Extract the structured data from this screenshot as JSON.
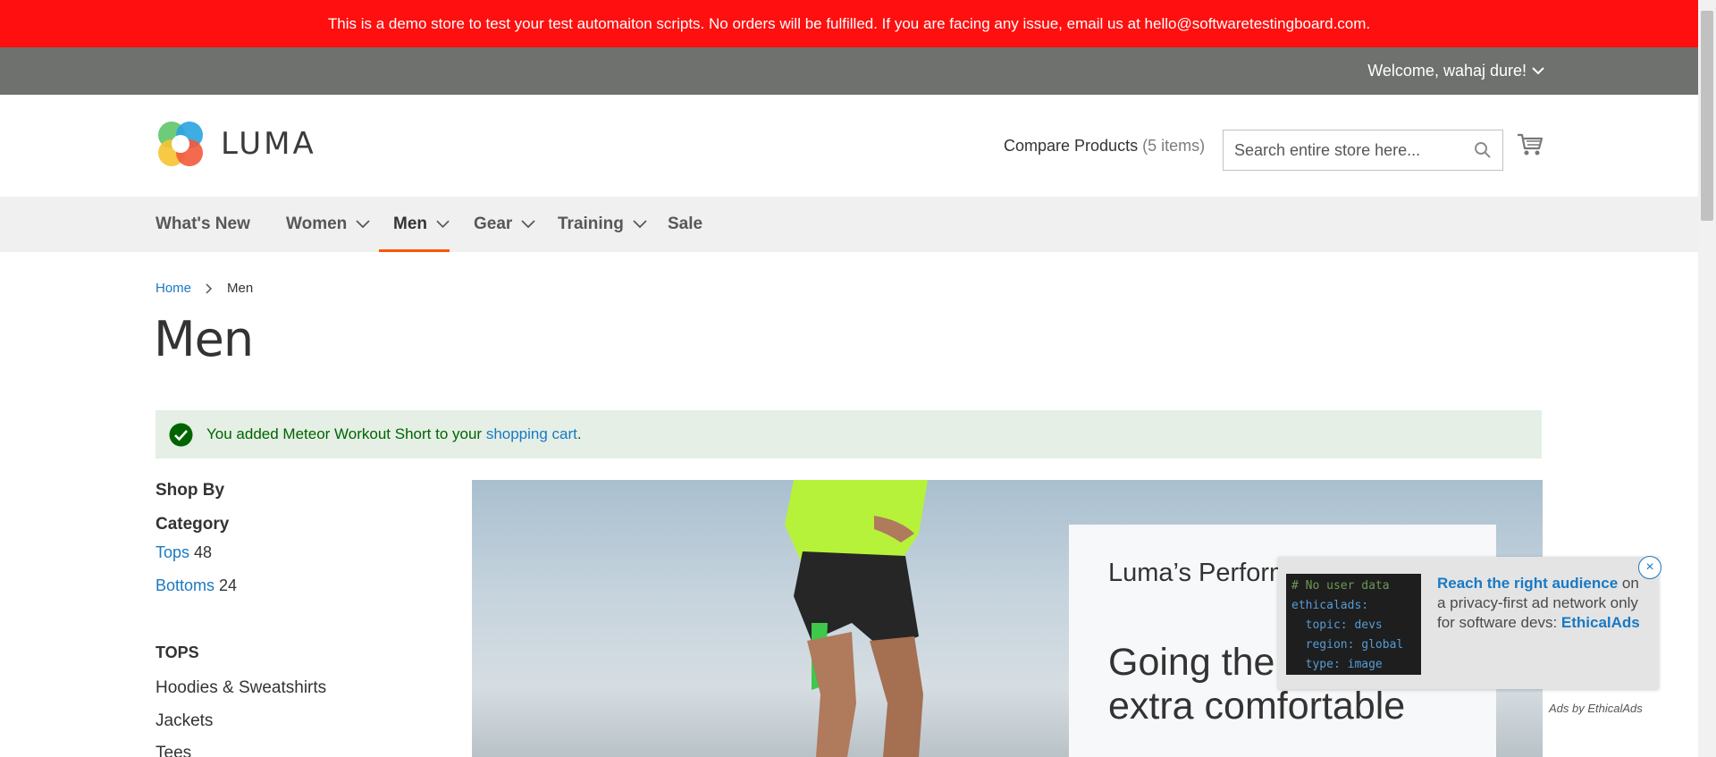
{
  "banner": {
    "text": "This is a demo store to test your test automaiton scripts. No orders will be fulfilled. If you are facing any issue, email us at hello@softwaretestingboard.com."
  },
  "account": {
    "welcome": "Welcome, wahaj dure!"
  },
  "header": {
    "logo_text": "LUMA",
    "compare_label": "Compare Products",
    "compare_count": "(5 items)",
    "search_placeholder": "Search entire store here..."
  },
  "nav": {
    "items": [
      {
        "label": "What's New"
      },
      {
        "label": "Women"
      },
      {
        "label": "Men"
      },
      {
        "label": "Gear"
      },
      {
        "label": "Training"
      },
      {
        "label": "Sale"
      }
    ],
    "active": "Men"
  },
  "breadcrumb": {
    "home": "Home",
    "current": "Men"
  },
  "page": {
    "title": "Men"
  },
  "message": {
    "prefix": "You added Meteor Workout Short to your ",
    "link": "shopping cart",
    "suffix": "."
  },
  "sidebar": {
    "shop_by": "Shop By",
    "category_title": "Category",
    "categories": [
      {
        "label": "Tops",
        "count": "48"
      },
      {
        "label": "Bottoms",
        "count": "24"
      }
    ],
    "tops_title": "TOPS",
    "tops_items": [
      {
        "label": "Hoodies & Sweatshirts"
      },
      {
        "label": "Jackets"
      },
      {
        "label": "Tees"
      }
    ]
  },
  "hero": {
    "subtitle": "Luma’s Perform collection",
    "headline": "Going the just got extra comfortable"
  },
  "ad": {
    "code_lines": [
      "# No user data",
      "ethicalads:",
      "  topic: devs",
      "  region: global",
      "  type: image"
    ],
    "headline": "Reach the right audience",
    "body": " on a privacy-first ad network only for software devs: ",
    "brand": "EthicalAds",
    "close": "×",
    "credit": "Ads by EthicalAds"
  },
  "colors": {
    "banner": "#ff0f0f",
    "accent": "#ff5501",
    "link": "#1979c3",
    "success_bg": "#e5efe5"
  }
}
